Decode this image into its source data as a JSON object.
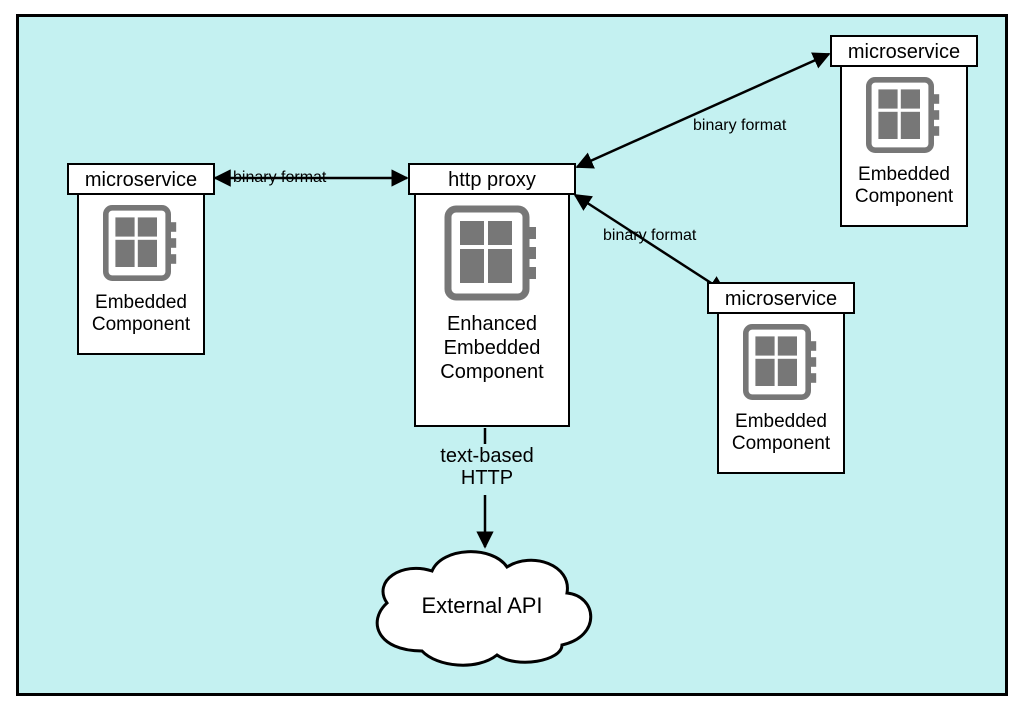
{
  "nodes": {
    "left": {
      "title": "microservice",
      "caption": "Embedded Component"
    },
    "center": {
      "title": "http proxy",
      "caption": "Enhanced Embedded Component"
    },
    "topright": {
      "title": "microservice",
      "caption": "Embedded Component"
    },
    "right": {
      "title": "microservice",
      "caption": "Embedded Component"
    },
    "cloud": {
      "label": "External API"
    }
  },
  "edges": {
    "left_center": "binary format",
    "center_topright": "binary format",
    "center_right": "binary format",
    "center_cloud": "text-based\nHTTP"
  }
}
